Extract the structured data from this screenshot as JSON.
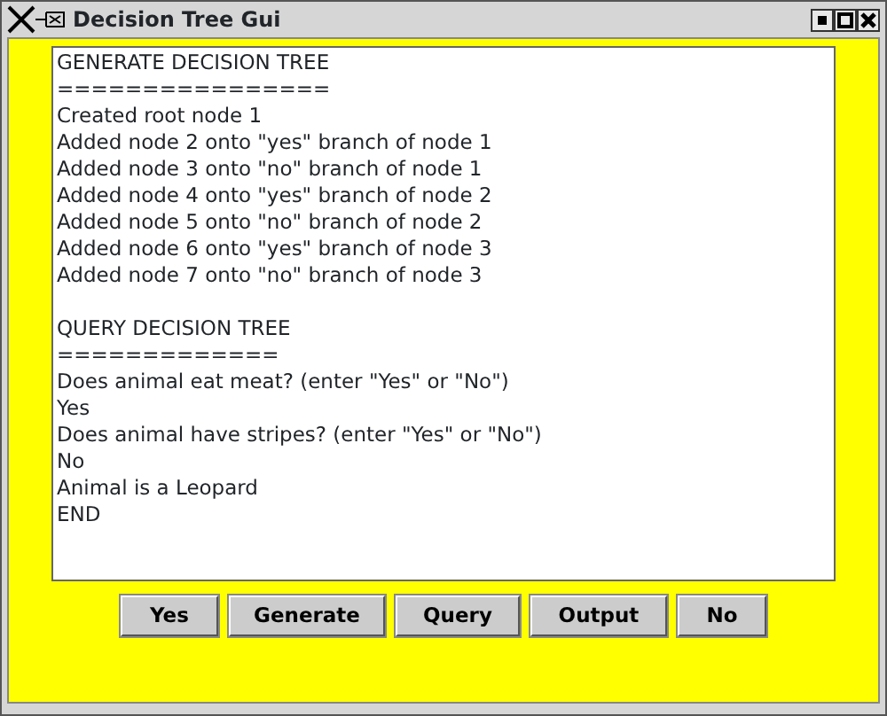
{
  "window": {
    "title": "Decision Tree Gui"
  },
  "output_sections": [
    {
      "lines": [
        "GENERATE DECISION TREE",
        "================",
        "Created root node 1",
        "Added node 2 onto \"yes\" branch of node 1",
        "Added node 3 onto \"no\" branch of node 1",
        "Added node 4 onto \"yes\" branch of node 2",
        "Added node 5 onto \"no\" branch of node 2",
        "Added node 6 onto \"yes\" branch of node 3",
        "Added node 7 onto \"no\" branch of node 3"
      ]
    },
    {
      "lines": [
        "QUERY DECISION TREE",
        "=============",
        "Does animal eat meat? (enter \"Yes\" or \"No\")",
        "Yes",
        "Does animal have stripes? (enter \"Yes\" or \"No\")",
        "No",
        "Animal is a Leopard",
        "END"
      ]
    }
  ],
  "buttons": [
    "Yes",
    "Generate",
    "Query",
    "Output",
    "No"
  ]
}
